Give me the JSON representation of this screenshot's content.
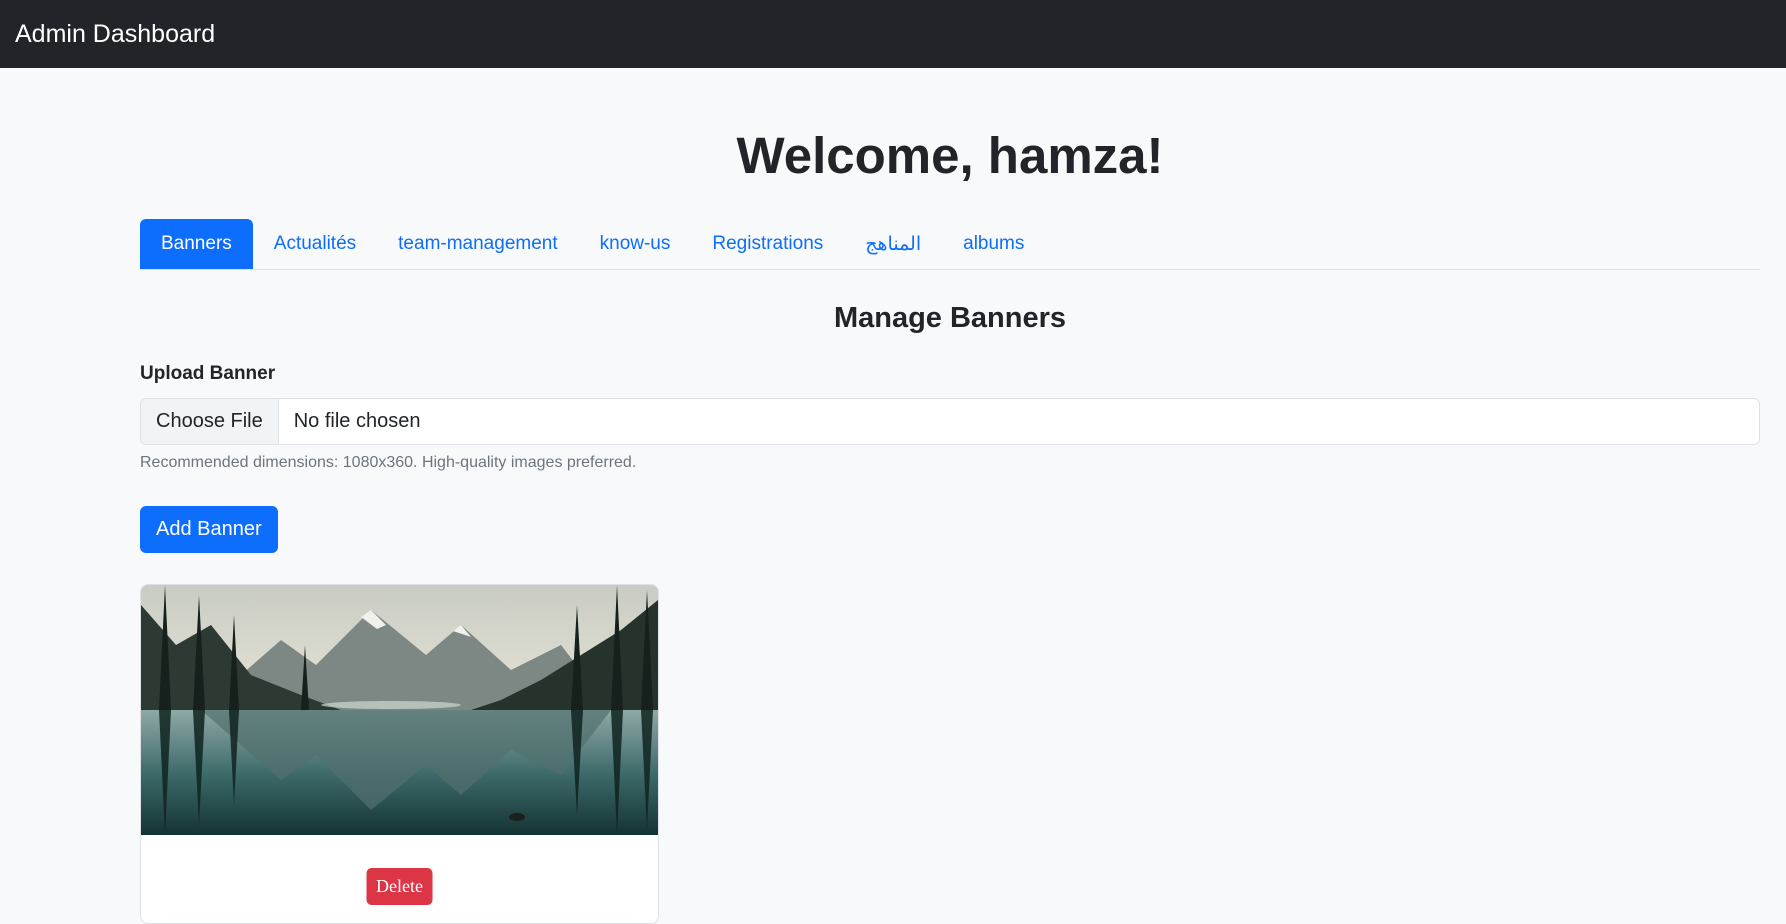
{
  "navbar": {
    "brand": "Admin Dashboard"
  },
  "welcome": "Welcome, hamza!",
  "tabs": [
    {
      "label": "Banners",
      "active": true
    },
    {
      "label": "Actualités",
      "active": false
    },
    {
      "label": "team-management",
      "active": false
    },
    {
      "label": "know-us",
      "active": false
    },
    {
      "label": "Registrations",
      "active": false
    },
    {
      "label": "المناهج",
      "active": false
    },
    {
      "label": "albums",
      "active": false
    }
  ],
  "section": {
    "title": "Manage Banners",
    "upload_label": "Upload Banner",
    "file_button": "Choose File",
    "file_status": "No file chosen",
    "help_text": "Recommended dimensions: 1080x360. High-quality images preferred.",
    "add_button": "Add Banner"
  },
  "banners": [
    {
      "image": "mountain-lake-landscape",
      "delete_label": "Delete"
    }
  ],
  "colors": {
    "navbar": "#212529",
    "primary": "#0d6efd",
    "danger": "#dc3545",
    "background": "#f8f9fa"
  }
}
